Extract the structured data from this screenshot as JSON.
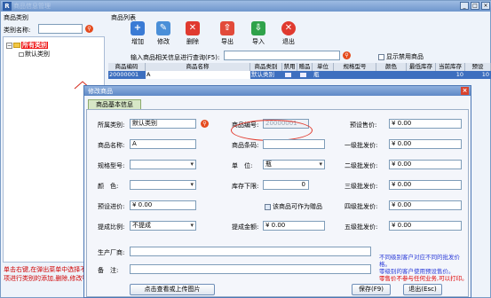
{
  "window": {
    "title": "商品信息管理",
    "app_icon": "R"
  },
  "left_panel": {
    "header": "商品类别",
    "category_label": "类别名称:",
    "category_value": "",
    "tree": [
      {
        "label": "所有类别",
        "selected": true
      },
      {
        "label": "默认类别",
        "selected": false
      }
    ],
    "tip": "单击右键,在弹出菜单中选择不同菜单项进行类别的添加,删除,修改等操作"
  },
  "right_panel": {
    "header": "商品列表",
    "toolbar": [
      {
        "label": "增加",
        "icon": "add-icon",
        "color": "#3a7bd5"
      },
      {
        "label": "修改",
        "icon": "edit-icon",
        "color": "#4a8fd8"
      },
      {
        "label": "删除",
        "icon": "delete-icon",
        "color": "#e03a2f"
      },
      {
        "label": "导出",
        "icon": "export-icon",
        "color": "#e24a3a"
      },
      {
        "label": "导入",
        "icon": "import-icon",
        "color": "#2fa24a"
      },
      {
        "label": "退出",
        "icon": "exit-icon",
        "color": "#e03a2f"
      }
    ],
    "search_label": "输入商品相关信息进行查询(F5):",
    "search_value": "",
    "show_disabled_label": "显示禁用商品",
    "grid": {
      "columns": [
        "商品编码",
        "商品名称",
        "商品类别",
        "禁用",
        "赠品",
        "单位",
        "规格型号",
        "颜色",
        "最低库存",
        "当前库存",
        "预设"
      ],
      "row": [
        "20000001",
        "A",
        "默认类别",
        "",
        "",
        "瓶",
        "",
        "",
        "",
        "10",
        "10"
      ]
    }
  },
  "dialog": {
    "title": "修改商品",
    "tab": "商品基本信息",
    "fields": {
      "category_label": "所属类别:",
      "category_value": "默认类别",
      "code_label": "商品编号:",
      "code_value": "20000001",
      "preset_price_label": "预设售价:",
      "preset_price_value": "¥ 0.00",
      "name_label": "商品名称:",
      "name_value": "A",
      "barcode_label": "商品条码:",
      "barcode_value": "",
      "level1_label": "一级批发价:",
      "level1_value": "¥ 0.00",
      "spec_label": "规格型号:",
      "spec_value": "",
      "unit_label": "单　位:",
      "unit_value": "瓶",
      "level2_label": "二级批发价:",
      "level2_value": "¥ 0.00",
      "color_label": "颜　色:",
      "color_value": "",
      "min_stock_label": "库存下限:",
      "min_stock_value": "0",
      "level3_label": "三级批发价:",
      "level3_value": "¥ 0.00",
      "purchase_label": "预设进价:",
      "purchase_value": "¥ 0.00",
      "gift_label": "该商品可作为赠品",
      "level4_label": "四级批发价:",
      "level4_value": "¥ 0.00",
      "commission_label": "提成比例:",
      "commission_value": "不提成",
      "commission_amount_label": "提成金额:",
      "commission_amount_value": "¥ 0.00",
      "level5_label": "五级批发价:",
      "level5_value": "¥ 0.00",
      "maker_label": "生产厂商:",
      "maker_value": "",
      "remark_label": "备　注:",
      "remark_value": ""
    },
    "note_blue1": "不同级别客户对应不同的批发价格。",
    "note_blue2": "零级别的客户使用预设售价。",
    "note_red": "零售价不参与任何业务,可以打印。",
    "view_image_button": "点击查看或上传图片",
    "save_button": "保存(F9)",
    "exit_button": "退出(Esc)"
  }
}
